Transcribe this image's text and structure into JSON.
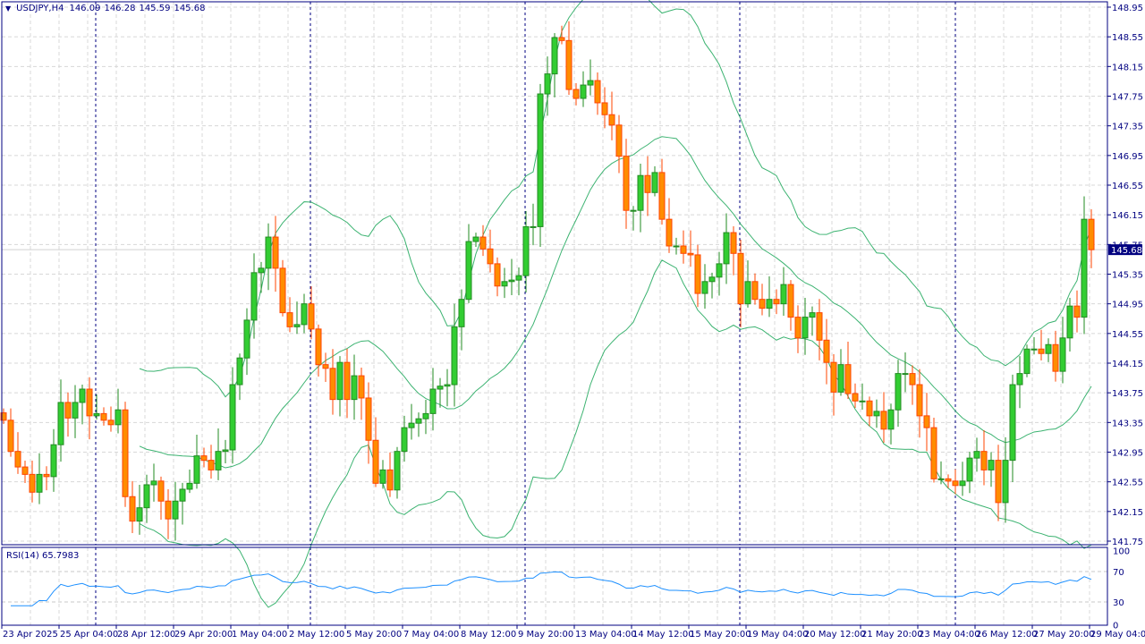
{
  "header": {
    "symbol": "USDJPY,H4",
    "open": "146.09",
    "high": "146.28",
    "low": "145.59",
    "close": "145.68"
  },
  "current_price": "145.68",
  "rsi": {
    "label": "RSI(14) 65.7983",
    "ticks": [
      "100",
      "70",
      "30",
      "0"
    ]
  },
  "colors": {
    "bull": "#32CD32",
    "bull_edge": "#228B22",
    "bear": "#FF8C00",
    "bear_edge": "#FF4500",
    "bands": "#3CB371",
    "rsi": "#1E90FF",
    "axis": "#000080"
  },
  "chart_data": {
    "type": "candlestick",
    "title": "USDJPY,H4",
    "indicators": [
      "Bollinger Bands (20,2)",
      "RSI(14)"
    ],
    "ylim": [
      141.75,
      148.95
    ],
    "y_ticks": [
      "148.95",
      "148.55",
      "148.15",
      "147.75",
      "147.35",
      "146.95",
      "146.55",
      "146.15",
      "145.75",
      "145.35",
      "144.95",
      "144.55",
      "144.15",
      "143.75",
      "143.35",
      "142.95",
      "142.55",
      "142.15",
      "141.75"
    ],
    "x_ticks": [
      "23 Apr 2025",
      "25 Apr 04:00",
      "28 Apr 12:00",
      "29 Apr 20:00",
      "1 May 04:00",
      "2 May 12:00",
      "5 May 20:00",
      "7 May 04:00",
      "8 May 12:00",
      "9 May 20:00",
      "13 May 04:00",
      "14 May 12:00",
      "15 May 20:00",
      "19 May 04:00",
      "20 May 12:00",
      "21 May 20:00",
      "23 May 04:00",
      "26 May 12:00",
      "27 May 20:00",
      "29 May 04:00"
    ],
    "closes": [
      143.38,
      142.96,
      142.75,
      142.65,
      142.41,
      142.65,
      142.62,
      143.05,
      143.62,
      143.41,
      143.62,
      143.8,
      143.44,
      143.47,
      143.38,
      143.32,
      143.52,
      142.35,
      142.02,
      142.2,
      142.51,
      142.56,
      142.29,
      142.05,
      142.29,
      142.45,
      142.53,
      142.9,
      142.84,
      142.71,
      142.96,
      142.98,
      143.86,
      144.22,
      144.73,
      145.37,
      145.43,
      145.85,
      145.43,
      144.83,
      144.64,
      144.67,
      144.95,
      144.61,
      144.13,
      144.08,
      143.66,
      144.16,
      143.66,
      143.98,
      143.68,
      143.11,
      142.53,
      142.71,
      142.44,
      142.96,
      143.28,
      143.34,
      143.4,
      143.47,
      143.8,
      143.84,
      143.86,
      144.64,
      145.01,
      145.79,
      145.85,
      145.69,
      145.49,
      145.19,
      145.25,
      145.27,
      145.33,
      145.99,
      145.99,
      147.78,
      148.05,
      148.54,
      148.5,
      147.84,
      147.72,
      147.9,
      147.96,
      147.66,
      147.5,
      147.36,
      146.94,
      146.21,
      146.21,
      146.68,
      146.45,
      146.72,
      146.09,
      145.73,
      145.73,
      145.63,
      145.61,
      145.09,
      145.25,
      145.31,
      145.49,
      145.91,
      145.63,
      144.95,
      145.25,
      145.01,
      144.89,
      145.01,
      144.95,
      145.21,
      144.77,
      144.49,
      144.77,
      144.83,
      144.46,
      144.16,
      143.76,
      144.13,
      143.74,
      143.64,
      143.64,
      143.44,
      143.5,
      143.26,
      143.52,
      144.01,
      144.01,
      143.86,
      143.44,
      143.28,
      142.59,
      142.59,
      142.56,
      142.5,
      142.56,
      142.87,
      142.96,
      142.71,
      142.84,
      142.27,
      142.84,
      143.86,
      144.01,
      144.34,
      144.34,
      144.28,
      144.4,
      144.04,
      144.49,
      144.92,
      144.77,
      146.09,
      145.68
    ]
  }
}
